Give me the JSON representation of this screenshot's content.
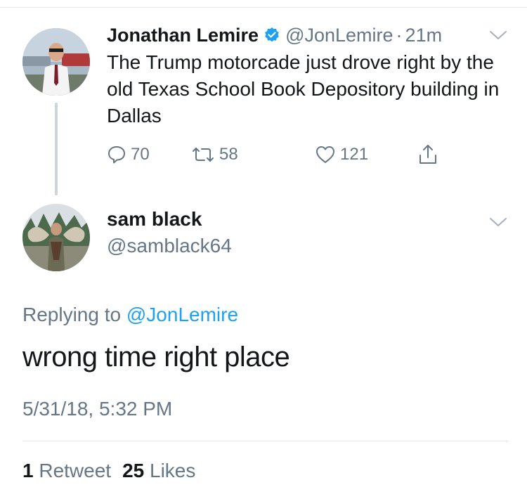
{
  "parent_tweet": {
    "name": "Jonathan Lemire",
    "verified_icon": "verified-badge-icon",
    "handle": "@JonLemire",
    "separator": "·",
    "time": "21m",
    "text": "The Trump motorcade just drove right by the old Texas School Book Depository building in Dallas",
    "actions": {
      "replies": "70",
      "retweets": "58",
      "likes": "121"
    }
  },
  "reply_tweet": {
    "name": "sam black",
    "handle": "@samblack64",
    "replying_prefix": "Replying to",
    "replying_mention": "@JonLemire",
    "text": "wrong time right place",
    "timestamp": "5/31/18, 5:32 PM",
    "stats": {
      "retweet_count": "1",
      "retweet_label": "Retweet",
      "like_count": "25",
      "like_label": "Likes"
    }
  },
  "colors": {
    "link": "#1da1f2",
    "secondary_text": "#657786",
    "primary_text": "#14171a",
    "divider": "#e1e8ed",
    "thread_line": "#ccd6dd"
  }
}
